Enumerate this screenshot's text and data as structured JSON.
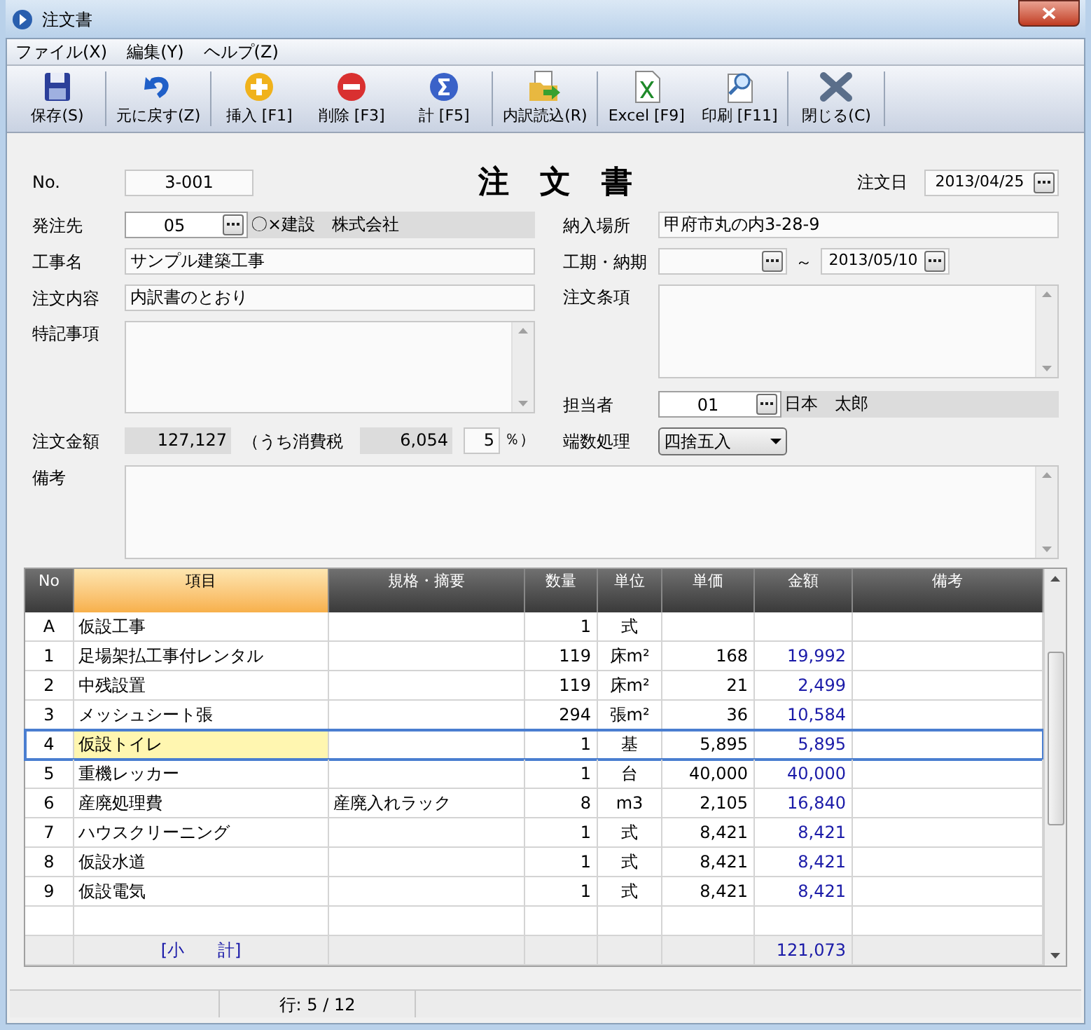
{
  "window": {
    "title": "注文書"
  },
  "menu": [
    {
      "label": "ファイル(X)"
    },
    {
      "label": "編集(Y)"
    },
    {
      "label": "ヘルプ(Z)"
    }
  ],
  "toolbar": [
    {
      "label": "保存(S)",
      "kind": "save"
    },
    {
      "label": "元に戻す(Z)",
      "kind": "undo"
    },
    {
      "label": "挿入 [F1]",
      "kind": "plus"
    },
    {
      "label": "削除 [F3]",
      "kind": "minus"
    },
    {
      "label": "計 [F5]",
      "kind": "sum"
    },
    {
      "label": "内訳読込(R)",
      "kind": "import"
    },
    {
      "label": "Excel [F9]",
      "kind": "excel"
    },
    {
      "label": "印刷 [F11]",
      "kind": "print"
    },
    {
      "label": "閉じる(C)",
      "kind": "close"
    }
  ],
  "form": {
    "title": "注　文　書",
    "number": {
      "label": "No.",
      "value": "3-001"
    },
    "order_date": {
      "label": "注文日",
      "value": "2013/04/25"
    },
    "supplier": {
      "label": "発注先",
      "code": "05",
      "name": "〇×建設　株式会社"
    },
    "project": {
      "label": "工事名",
      "value": "サンプル建築工事"
    },
    "content": {
      "label": "注文内容",
      "value": "内訳書のとおり"
    },
    "notes": {
      "label": "特記事項"
    },
    "amount": {
      "label": "注文金額",
      "value": "127,127",
      "tax_label": "（うち消費税",
      "tax": "6,054",
      "rate": "5",
      "rate_suffix": "％）"
    },
    "delivery_place": {
      "label": "納入場所",
      "value": "甲府市丸の内3-28-9"
    },
    "period": {
      "label": "工期・納期",
      "separator": "～",
      "end": "2013/05/10"
    },
    "terms": {
      "label": "注文条項"
    },
    "staff": {
      "label": "担当者",
      "code": "01",
      "name": "日本　太郎"
    },
    "rounding": {
      "label": "端数処理",
      "value": "四捨五入"
    },
    "remarks": {
      "label": "備考"
    }
  },
  "table": {
    "columns": [
      {
        "label": "No",
        "selected": false
      },
      {
        "label": "項目",
        "selected": true
      },
      {
        "label": "規格・摘要",
        "selected": false
      },
      {
        "label": "数量",
        "selected": false
      },
      {
        "label": "単位",
        "selected": false
      },
      {
        "label": "単価",
        "selected": false
      },
      {
        "label": "金額",
        "selected": false
      },
      {
        "label": "備考",
        "selected": false
      }
    ],
    "rows": [
      {
        "kind": "item",
        "selected": false,
        "no": "A",
        "item": "仮設工事",
        "qty": "1",
        "unit": "式"
      },
      {
        "kind": "item",
        "selected": false,
        "no": "1",
        "item": "足場架払工事付レンタル",
        "qty": "119",
        "unit": "床m²",
        "price": "168",
        "amount": "19,992"
      },
      {
        "kind": "item",
        "selected": false,
        "no": "2",
        "item": "中残設置",
        "qty": "119",
        "unit": "床m²",
        "price": "21",
        "amount": "2,499"
      },
      {
        "kind": "item",
        "selected": false,
        "no": "3",
        "item": "メッシュシート張",
        "qty": "294",
        "unit": "張m²",
        "price": "36",
        "amount": "10,584"
      },
      {
        "kind": "item",
        "selected": true,
        "no": "4",
        "item": "仮設トイレ",
        "qty": "1",
        "unit": "基",
        "price": "5,895",
        "amount": "5,895"
      },
      {
        "kind": "item",
        "selected": false,
        "no": "5",
        "item": "重機レッカー",
        "qty": "1",
        "unit": "台",
        "price": "40,000",
        "amount": "40,000"
      },
      {
        "kind": "item",
        "selected": false,
        "no": "6",
        "item": "産廃処理費",
        "spec": "産廃入れラック",
        "qty": "8",
        "unit": "m3",
        "price": "2,105",
        "amount": "16,840"
      },
      {
        "kind": "item",
        "selected": false,
        "no": "7",
        "item": "ハウスクリーニング",
        "qty": "1",
        "unit": "式",
        "price": "8,421",
        "amount": "8,421"
      },
      {
        "kind": "item",
        "selected": false,
        "no": "8",
        "item": "仮設水道",
        "qty": "1",
        "unit": "式",
        "price": "8,421",
        "amount": "8,421"
      },
      {
        "kind": "item",
        "selected": false,
        "no": "9",
        "item": "仮設電気",
        "qty": "1",
        "unit": "式",
        "price": "8,421",
        "amount": "8,421"
      },
      {
        "kind": "blank",
        "selected": false
      },
      {
        "kind": "subtotal",
        "selected": false,
        "item": "[小　　計]",
        "amount": "121,073"
      }
    ]
  },
  "status_bar": {
    "row": "行: 5 / 12"
  }
}
